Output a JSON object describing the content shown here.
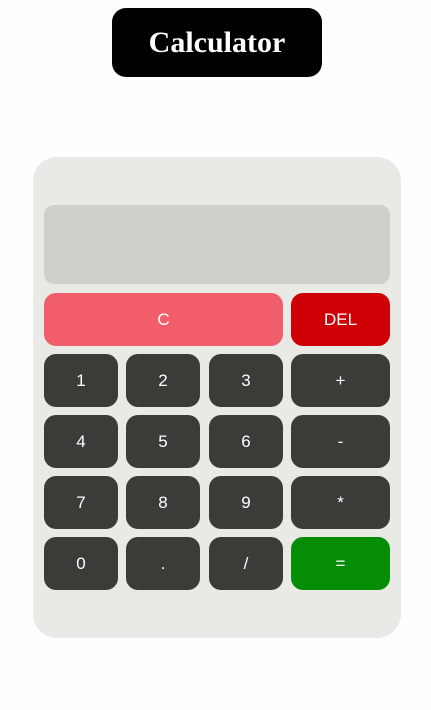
{
  "header": {
    "title": "Calculator"
  },
  "calculator": {
    "display_value": "",
    "buttons": {
      "clear": "C",
      "del": "DEL",
      "one": "1",
      "two": "2",
      "three": "3",
      "plus": "+",
      "four": "4",
      "five": "5",
      "six": "6",
      "minus": "-",
      "seven": "7",
      "eight": "8",
      "nine": "9",
      "multiply": "*",
      "zero": "0",
      "dot": ".",
      "divide": "/",
      "equals": "="
    }
  },
  "colors": {
    "title_background": "#000000",
    "panel_background": "#e9e9e5",
    "display_background": "#cfcfcb",
    "number_button": "#3d3b37",
    "clear_button": "#f15d6b",
    "delete_button": "#cf0005",
    "equals_button": "#058e05"
  }
}
